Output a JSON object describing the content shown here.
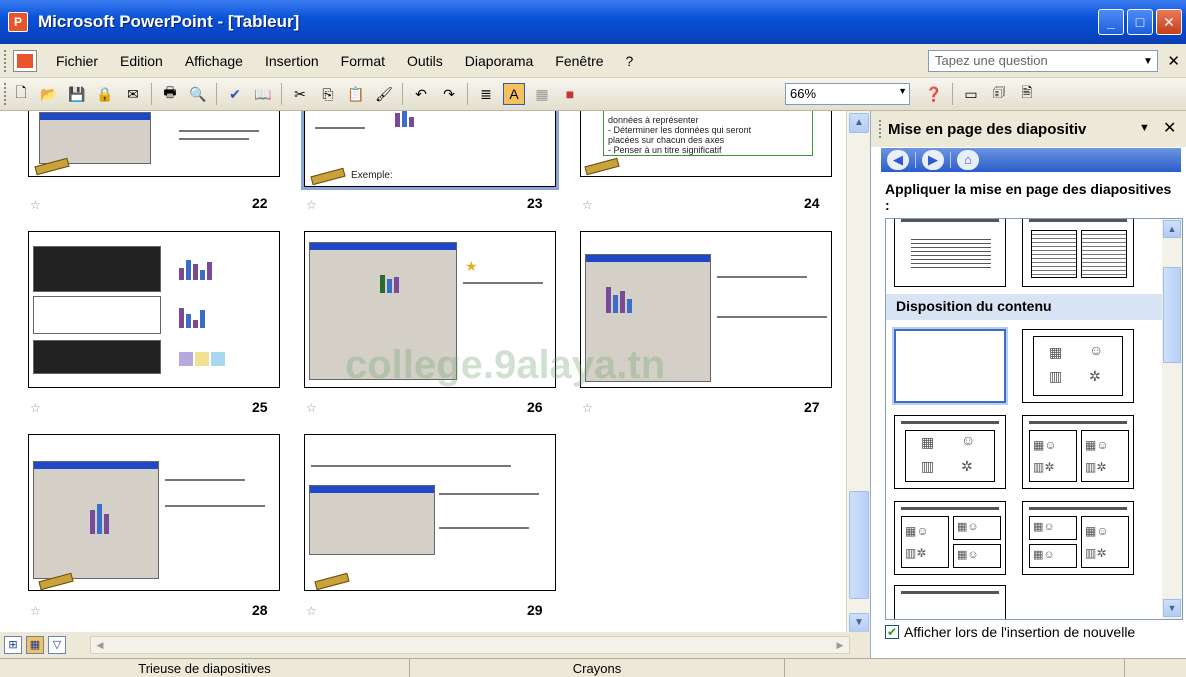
{
  "window": {
    "title": "Microsoft PowerPoint - [Tableur]"
  },
  "menu": {
    "items": [
      "Fichier",
      "Edition",
      "Affichage",
      "Insertion",
      "Format",
      "Outils",
      "Diaporama",
      "Fenêtre",
      "?"
    ],
    "ask_placeholder": "Tapez une question"
  },
  "toolbar": {
    "zoom": "66%"
  },
  "sorter": {
    "slides": [
      {
        "num": "22"
      },
      {
        "num": "23"
      },
      {
        "num": "24"
      },
      {
        "num": "25"
      },
      {
        "num": "26"
      },
      {
        "num": "27"
      },
      {
        "num": "28"
      },
      {
        "num": "29"
      }
    ],
    "slide23_caption": "Exemple:",
    "slide24_lines": [
      "données à représenter",
      "- Déterminer les données qui seront",
      "placées sur chacun des axes",
      "- Penser à un titre significatif"
    ]
  },
  "watermark": "college.9alaya.tn",
  "taskpane": {
    "title": "Mise en page des diapositiv",
    "apply_label": "Appliquer la mise en page des diapositives :",
    "section_label": "Disposition du contenu",
    "checkbox_label": "Afficher lors de l'insertion de nouvelle"
  },
  "status": {
    "view": "Trieuse de diapositives",
    "design": "Crayons"
  },
  "colors": {
    "titlebar": "#0a53d8",
    "selection": "#8aa6d8"
  }
}
